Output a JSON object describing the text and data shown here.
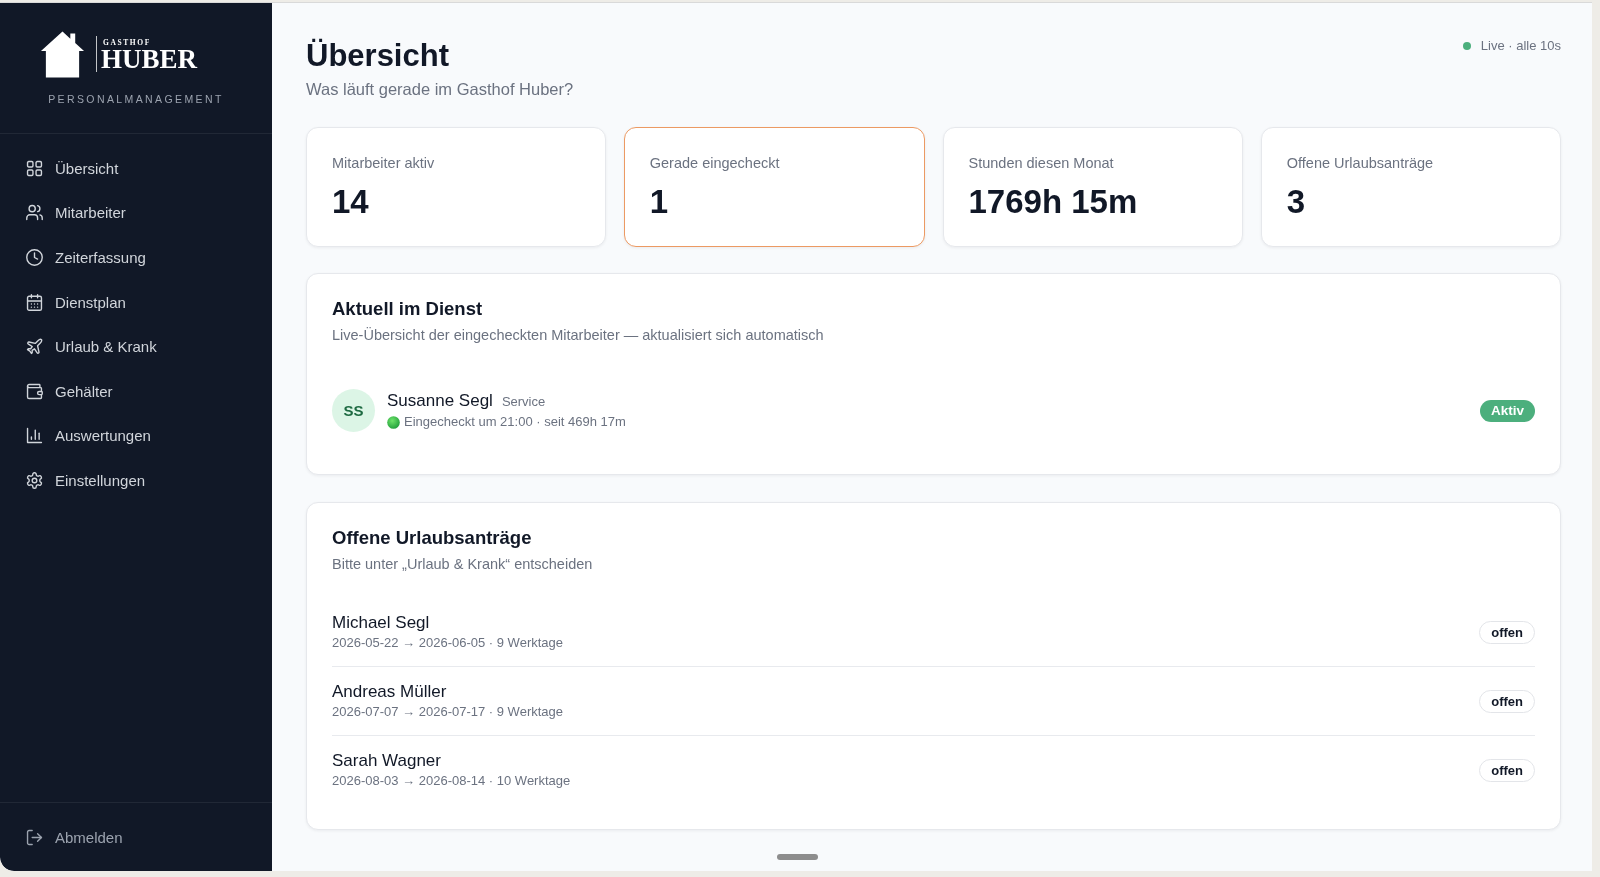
{
  "sidebar": {
    "logo": {
      "small_text": "GASTHOF",
      "name": "HUBER"
    },
    "tagline": "PERSONALMANAGEMENT",
    "items": [
      {
        "label": "Übersicht",
        "selected": false
      },
      {
        "label": "Mitarbeiter",
        "selected": false
      },
      {
        "label": "Zeiterfassung",
        "selected": false
      },
      {
        "label": "Dienstplan",
        "selected": false
      },
      {
        "label": "Urlaub & Krank",
        "selected": false
      },
      {
        "label": "Gehälter",
        "selected": false
      },
      {
        "label": "Auswertungen",
        "selected": false
      },
      {
        "label": "Einstellungen",
        "selected": false
      }
    ],
    "footer_item": {
      "label": "Abmelden"
    }
  },
  "header": {
    "title": "Übersicht",
    "subtitle": "Was läuft gerade im Gasthof Huber?",
    "live_indicator": "Live · alle 10s"
  },
  "stats": [
    {
      "label": "Mitarbeiter aktiv",
      "value": "14",
      "highlighted": false
    },
    {
      "label": "Gerade eingecheckt",
      "value": "1",
      "highlighted": true
    },
    {
      "label": "Stunden diesen Monat",
      "value": "1769h 15m",
      "highlighted": false
    },
    {
      "label": "Offene Urlaubsanträge",
      "value": "3",
      "highlighted": false
    }
  ],
  "on_duty": {
    "title": "Aktuell im Dienst",
    "subtitle": "Live-Übersicht der eingecheckten Mitarbeiter — aktualisiert sich automatisch",
    "people": [
      {
        "initials": "SS",
        "name": "Susanne Segl",
        "role": "Service",
        "status_line": "Eingecheckt um 21:00 · seit 469h 17m",
        "badge": "Aktiv"
      }
    ]
  },
  "leave_requests": {
    "title": "Offene Urlaubsanträge",
    "subtitle": "Bitte unter „Urlaub & Krank“ entscheiden",
    "rows": [
      {
        "name": "Michael Segl",
        "details": "2026-05-22 → 2026-06-05 · 9 Werktage",
        "status": "offen"
      },
      {
        "name": "Andreas Müller",
        "details": "2026-07-07 → 2026-07-17 · 9 Werktage",
        "status": "offen"
      },
      {
        "name": "Sarah Wagner",
        "details": "2026-08-03 → 2026-08-14 · 10 Werktage",
        "status": "offen"
      }
    ]
  }
}
